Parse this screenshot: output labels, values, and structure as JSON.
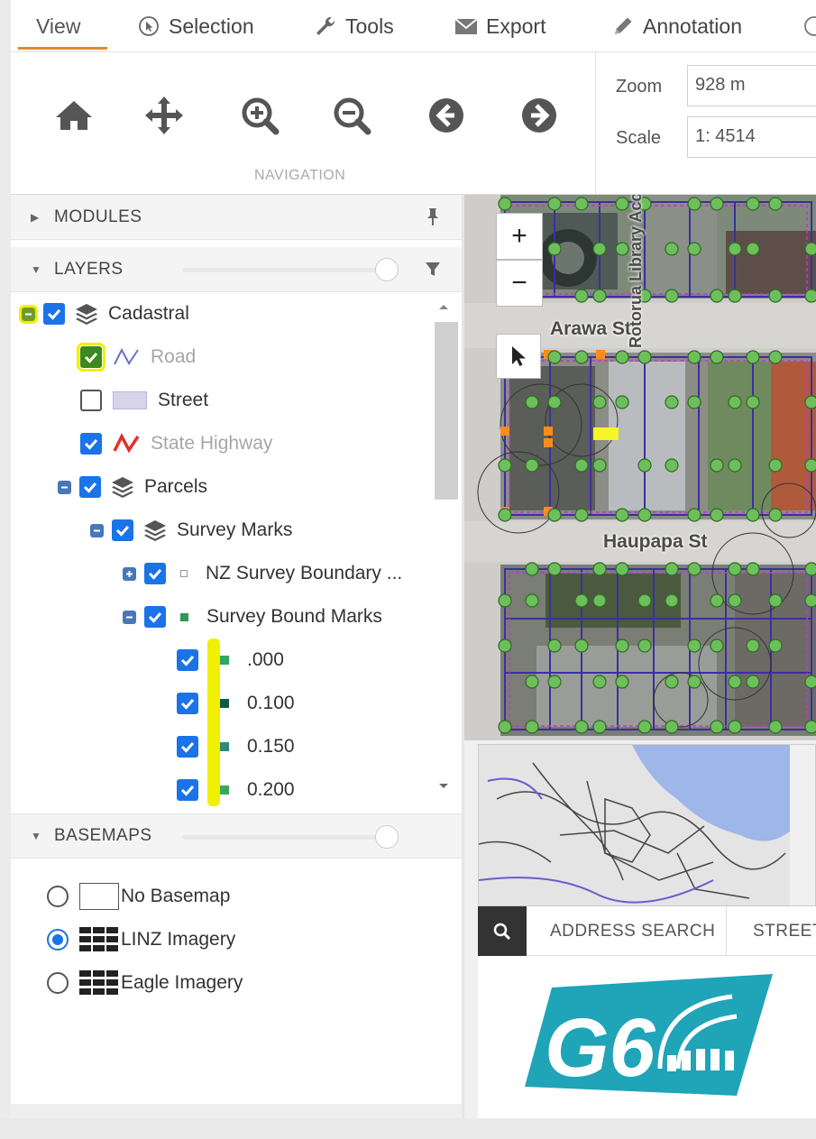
{
  "ribbon_tabs": [
    {
      "label": "View",
      "icon": "none"
    },
    {
      "label": "Selection",
      "icon": "cursor-circle-icon"
    },
    {
      "label": "Tools",
      "icon": "wrench-icon"
    },
    {
      "label": "Export",
      "icon": "envelope-icon"
    },
    {
      "label": "Annotation",
      "icon": "pencil-icon"
    }
  ],
  "navigation": {
    "group_label": "NAVIGATION",
    "buttons": [
      "home-icon",
      "pan-icon",
      "zoom-in-icon",
      "zoom-out-icon",
      "back-icon",
      "forward-icon"
    ]
  },
  "zoom_field": {
    "label": "Zoom",
    "value": "928 m"
  },
  "scale_field": {
    "label": "Scale",
    "value": "1: 4514"
  },
  "modules": {
    "title": "MODULES"
  },
  "layers": {
    "title": "LAYERS",
    "items": [
      {
        "label": "Cadastral",
        "checked": true
      },
      {
        "label": "Road",
        "checked": true
      },
      {
        "label": "Street",
        "checked": false
      },
      {
        "label": "State Highway",
        "checked": true
      },
      {
        "label": "Parcels",
        "checked": true
      },
      {
        "label": "Survey Marks",
        "checked": true
      },
      {
        "label": "NZ Survey Boundary ...",
        "checked": true
      },
      {
        "label": "Survey Bound Marks",
        "checked": true
      },
      {
        "label": ".000",
        "checked": true
      },
      {
        "label": "0.100",
        "checked": true
      },
      {
        "label": "0.150",
        "checked": true
      },
      {
        "label": "0.200",
        "checked": true
      }
    ]
  },
  "basemaps": {
    "title": "BASEMAPS",
    "options": [
      {
        "label": "No Basemap",
        "selected": false
      },
      {
        "label": "LINZ Imagery",
        "selected": true
      },
      {
        "label": "Eagle Imagery",
        "selected": false
      }
    ]
  },
  "map": {
    "zoom_in": "+",
    "zoom_out": "−",
    "labels": [
      "Arawa St",
      "Haupapa St",
      "Rotorua Library Acc"
    ]
  },
  "search": {
    "tabs": [
      "ADDRESS SEARCH",
      "STREET"
    ]
  },
  "logo": {
    "text": "G6"
  },
  "colors": {
    "accent": "#e08b33",
    "checkbox": "#1a73e8",
    "highlight": "#f1f000",
    "logo": "#1fa4b8"
  }
}
